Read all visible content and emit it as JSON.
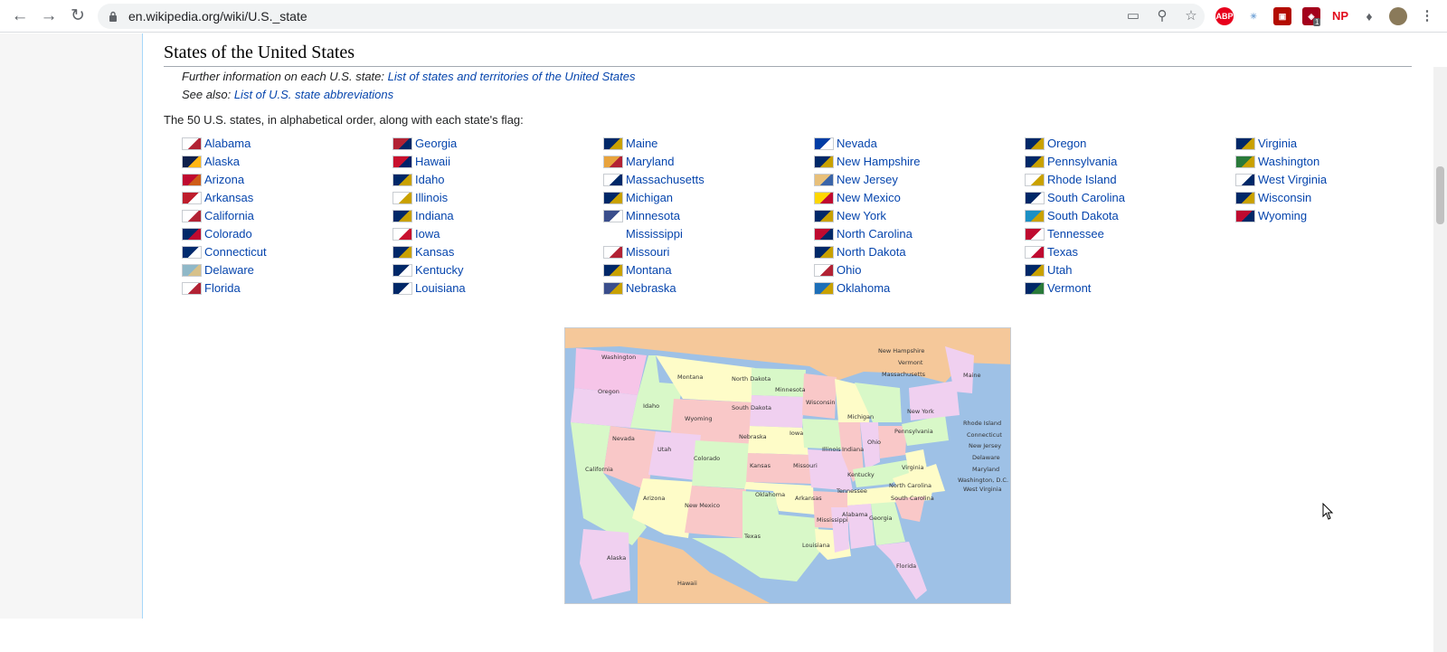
{
  "browser": {
    "url": "en.wikipedia.org/wiki/U.S._state",
    "extensions": [
      "ABP",
      "NP"
    ],
    "badge_count": "1"
  },
  "section": {
    "title": "States of the United States",
    "further_info_prefix": "Further information on each U.S. state: ",
    "further_info_link": "List of states and territories of the United States",
    "see_also_prefix": "See also: ",
    "see_also_link": "List of U.S. state abbreviations",
    "intro": "The 50 U.S. states, in alphabetical order, along with each state's flag:"
  },
  "states": [
    [
      {
        "name": "Alabama",
        "flag": "#ffffff",
        "mark": "#b22234"
      },
      {
        "name": "Alaska",
        "flag": "#0f204b",
        "mark": "#ffb612"
      },
      {
        "name": "Arizona",
        "flag": "#bf0a30",
        "mark": "#ce5c17"
      },
      {
        "name": "Arkansas",
        "flag": "#be1e2d",
        "mark": "#ffffff"
      },
      {
        "name": "California",
        "flag": "#ffffff",
        "mark": "#b22234"
      },
      {
        "name": "Colorado",
        "flag": "#002868",
        "mark": "#bf0a30"
      },
      {
        "name": "Connecticut",
        "flag": "#002b6e",
        "mark": "#ffffff"
      },
      {
        "name": "Delaware",
        "flag": "#8fb8c8",
        "mark": "#d7c18a"
      },
      {
        "name": "Florida",
        "flag": "#ffffff",
        "mark": "#b22234"
      }
    ],
    [
      {
        "name": "Georgia",
        "flag": "#b22234",
        "mark": "#002868"
      },
      {
        "name": "Hawaii",
        "flag": "#c8102e",
        "mark": "#012169"
      },
      {
        "name": "Idaho",
        "flag": "#002868",
        "mark": "#c9a100"
      },
      {
        "name": "Illinois",
        "flag": "#ffffff",
        "mark": "#c9a100"
      },
      {
        "name": "Indiana",
        "flag": "#002868",
        "mark": "#c9a100"
      },
      {
        "name": "Iowa",
        "flag": "#ffffff",
        "mark": "#c8102e"
      },
      {
        "name": "Kansas",
        "flag": "#002868",
        "mark": "#c9a100"
      },
      {
        "name": "Kentucky",
        "flag": "#002868",
        "mark": "#ffffff"
      },
      {
        "name": "Louisiana",
        "flag": "#002868",
        "mark": "#ffffff"
      }
    ],
    [
      {
        "name": "Maine",
        "flag": "#002868",
        "mark": "#c9a100"
      },
      {
        "name": "Maryland",
        "flag": "#e8a33d",
        "mark": "#b22234"
      },
      {
        "name": "Massachusetts",
        "flag": "#ffffff",
        "mark": "#002868"
      },
      {
        "name": "Michigan",
        "flag": "#002868",
        "mark": "#c9a100"
      },
      {
        "name": "Minnesota",
        "flag": "#3a4e8c",
        "mark": "#ffffff"
      },
      {
        "name": "Mississippi",
        "flag": "none",
        "mark": "none"
      },
      {
        "name": "Missouri",
        "flag": "#ffffff",
        "mark": "#b22234"
      },
      {
        "name": "Montana",
        "flag": "#002868",
        "mark": "#c9a100"
      },
      {
        "name": "Nebraska",
        "flag": "#3a4e8c",
        "mark": "#c9a100"
      }
    ],
    [
      {
        "name": "Nevada",
        "flag": "#003da5",
        "mark": "#ffffff"
      },
      {
        "name": "New Hampshire",
        "flag": "#002868",
        "mark": "#c9a100"
      },
      {
        "name": "New Jersey",
        "flag": "#e8c07a",
        "mark": "#3a64a8"
      },
      {
        "name": "New Mexico",
        "flag": "#ffd700",
        "mark": "#bf0a30"
      },
      {
        "name": "New York",
        "flag": "#002868",
        "mark": "#c9a100"
      },
      {
        "name": "North Carolina",
        "flag": "#bf0a30",
        "mark": "#002868"
      },
      {
        "name": "North Dakota",
        "flag": "#002868",
        "mark": "#c9a100"
      },
      {
        "name": "Ohio",
        "flag": "#ffffff",
        "mark": "#b22234"
      },
      {
        "name": "Oklahoma",
        "flag": "#1d6fb8",
        "mark": "#c9a100"
      }
    ],
    [
      {
        "name": "Oregon",
        "flag": "#002868",
        "mark": "#c9a100"
      },
      {
        "name": "Pennsylvania",
        "flag": "#002868",
        "mark": "#c9a100"
      },
      {
        "name": "Rhode Island",
        "flag": "#ffffff",
        "mark": "#c9a100"
      },
      {
        "name": "South Carolina",
        "flag": "#002868",
        "mark": "#ffffff"
      },
      {
        "name": "South Dakota",
        "flag": "#1b8fc4",
        "mark": "#c9a100"
      },
      {
        "name": "Tennessee",
        "flag": "#bf0a30",
        "mark": "#ffffff"
      },
      {
        "name": "Texas",
        "flag": "#ffffff",
        "mark": "#bf0a30"
      },
      {
        "name": "Utah",
        "flag": "#002868",
        "mark": "#c9a100"
      },
      {
        "name": "Vermont",
        "flag": "#002868",
        "mark": "#2a7a3a"
      }
    ],
    [
      {
        "name": "Virginia",
        "flag": "#002868",
        "mark": "#c9a100"
      },
      {
        "name": "Washington",
        "flag": "#2a7a3a",
        "mark": "#c9a100"
      },
      {
        "name": "West Virginia",
        "flag": "#ffffff",
        "mark": "#002868"
      },
      {
        "name": "Wisconsin",
        "flag": "#002868",
        "mark": "#c9a100"
      },
      {
        "name": "Wyoming",
        "flag": "#bf0a30",
        "mark": "#002868"
      }
    ]
  ],
  "map_labels": [
    "Washington",
    "Oregon",
    "California",
    "Nevada",
    "Idaho",
    "Montana",
    "Wyoming",
    "Utah",
    "Arizona",
    "Colorado",
    "New Mexico",
    "North Dakota",
    "South Dakota",
    "Nebraska",
    "Kansas",
    "Oklahoma",
    "Texas",
    "Minnesota",
    "Iowa",
    "Missouri",
    "Arkansas",
    "Louisiana",
    "Wisconsin",
    "Illinois",
    "Mississippi",
    "Michigan",
    "Indiana",
    "Ohio",
    "Kentucky",
    "Tennessee",
    "Alabama",
    "Georgia",
    "Florida",
    "South Carolina",
    "North Carolina",
    "Virginia",
    "West Virginia",
    "Pennsylvania",
    "New York",
    "Maine",
    "New Hampshire",
    "Vermont",
    "Massachusetts",
    "Rhode Island",
    "Connecticut",
    "New Jersey",
    "Delaware",
    "Maryland",
    "Washington, D.C.",
    "Alaska",
    "Hawaii"
  ]
}
